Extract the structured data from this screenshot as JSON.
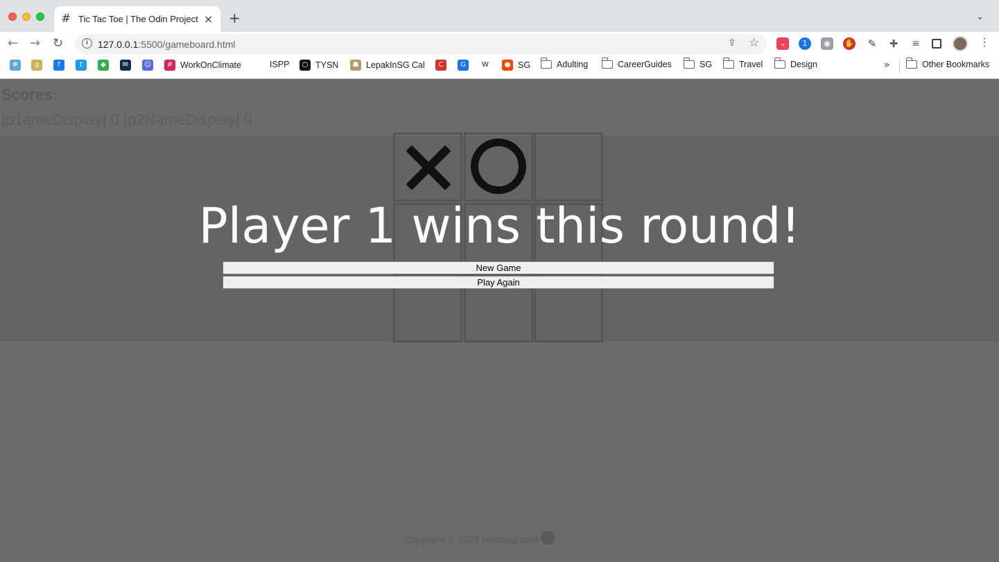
{
  "browser": {
    "tab": {
      "title": "Tic Tac Toe | The Odin Project",
      "favicon": "hash-grid-icon"
    },
    "url": {
      "host": "127.0.0.1",
      "rest": ":5500/gameboard.html"
    },
    "bookmarks": [
      {
        "label": "",
        "icon": "tree-icon",
        "color": "#5ba7d8"
      },
      {
        "label": "",
        "icon": "g-icon",
        "color": "#c8b25a"
      },
      {
        "label": "",
        "icon": "facebook-icon",
        "color": "#1877f2"
      },
      {
        "label": "",
        "icon": "twitter-icon",
        "color": "#1d9bf0"
      },
      {
        "label": "",
        "icon": "feedly-icon",
        "color": "#2bb24c"
      },
      {
        "label": "",
        "icon": "mail-icon",
        "color": "#0f2c4c"
      },
      {
        "label": "",
        "icon": "discord-icon",
        "color": "#5865f2"
      },
      {
        "label": "WorkOnClimate",
        "icon": "slack-icon",
        "color": "#e01e5a"
      },
      {
        "label": "ISPP",
        "icon": "",
        "color": ""
      },
      {
        "label": "TYSN",
        "icon": "circle-icon",
        "color": "#111111"
      },
      {
        "label": "LepakInSG Cal",
        "icon": "lepak-icon",
        "color": "#b59a6b"
      },
      {
        "label": "",
        "icon": "cape-icon",
        "color": "#d93025"
      },
      {
        "label": "",
        "icon": "gcal-icon",
        "color": "#1a73e8"
      },
      {
        "label": "",
        "icon": "wikipedia-icon",
        "color": "#202124"
      },
      {
        "label": "SG",
        "icon": "reddit-icon",
        "color": "#ff4500"
      },
      {
        "label": "Adulting",
        "icon": "folder-icon",
        "color": ""
      },
      {
        "label": "CareerGuides",
        "icon": "folder-icon",
        "color": ""
      },
      {
        "label": "SG",
        "icon": "folder-icon",
        "color": ""
      },
      {
        "label": "Travel",
        "icon": "folder-icon",
        "color": ""
      },
      {
        "label": "Design",
        "icon": "folder-icon",
        "color": ""
      }
    ],
    "other_bookmarks": "Other Bookmarks"
  },
  "page": {
    "scores_heading": "Scores:",
    "scores_line": "[p1ameDisplay] 0 [p2NameDisplay] 0",
    "board": [
      "X",
      "O",
      "",
      "",
      "",
      "",
      "",
      "",
      ""
    ],
    "overlay": {
      "title": "Player 1 wins this round!",
      "new_game": "New Game",
      "play_again": "Play Again"
    },
    "footer": "Copyright © 2023 hestnegrasef"
  }
}
